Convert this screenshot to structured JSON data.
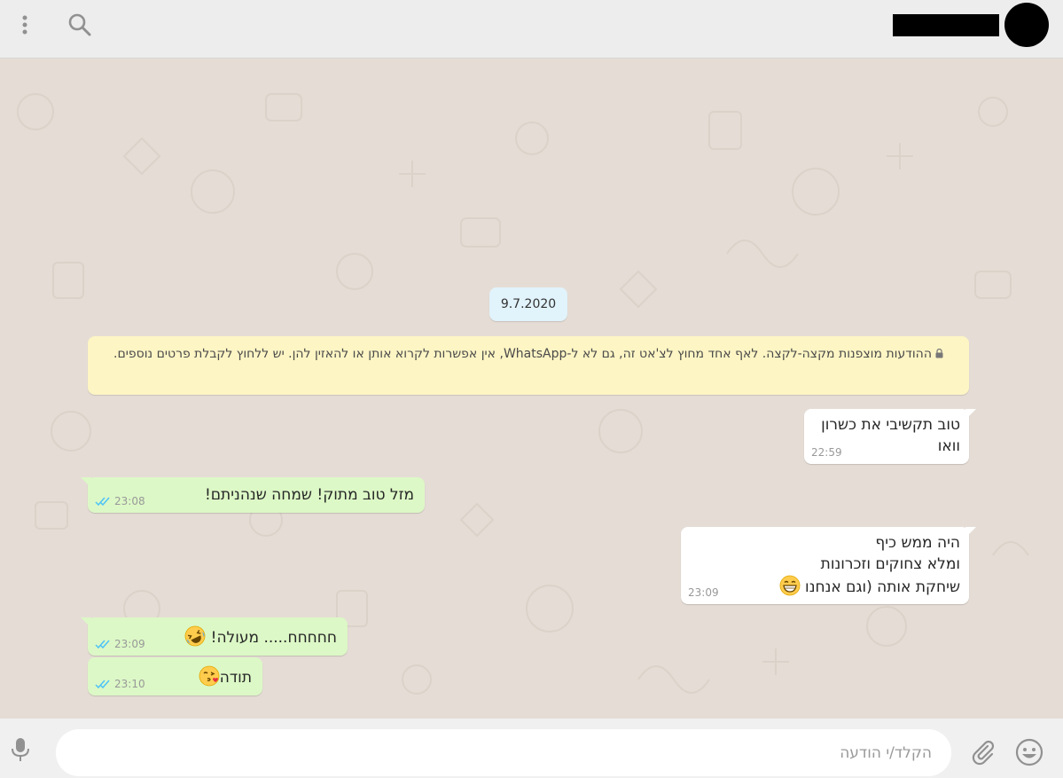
{
  "header": {
    "menu_icon": "vertical-dots-icon",
    "search_icon": "search-icon"
  },
  "chat": {
    "date": "9.7.2020",
    "encryption_notice": "ההודעות מוצפנות מקצה-לקצה. לאף אחד מחוץ לצ'אט זה, גם לא ל-WhatsApp, אין אפשרות לקרוא אותן או להאזין להן. יש ללחוץ לקבלת פרטים נוספים.",
    "messages": [
      {
        "direction": "in",
        "text": "טוב תקשיבי את כשרון\nוואו",
        "time": "22:59"
      },
      {
        "direction": "out",
        "text": "מזל טוב מתוק! שמחה שנהניתם!",
        "time": "23:08"
      },
      {
        "direction": "in",
        "text": "היה ממש כיף\nומלא צחוקים וזכרונות\nשיחקת אותה (וגם אנחנו ",
        "time": "23:09",
        "emoji": "grinning-face-emoji"
      },
      {
        "direction": "out",
        "text": "חחחחח..... מעולה! ",
        "time": "23:09",
        "emoji": "rolling-laughing-emoji"
      },
      {
        "direction": "out",
        "text": "תודה",
        "time": "23:10",
        "emoji": "kissing-heart-emoji"
      }
    ]
  },
  "footer": {
    "placeholder": "הקלד/י הודעה",
    "value": ""
  },
  "colors": {
    "header_bg": "#ededed",
    "chat_bg": "#e5ddd5",
    "incoming_bubble": "#ffffff",
    "outgoing_bubble": "#dcf8c6",
    "read_ticks": "#4fc3f7",
    "encryption_bg": "#fdf5c4",
    "date_chip_bg": "#e1f3fb"
  }
}
